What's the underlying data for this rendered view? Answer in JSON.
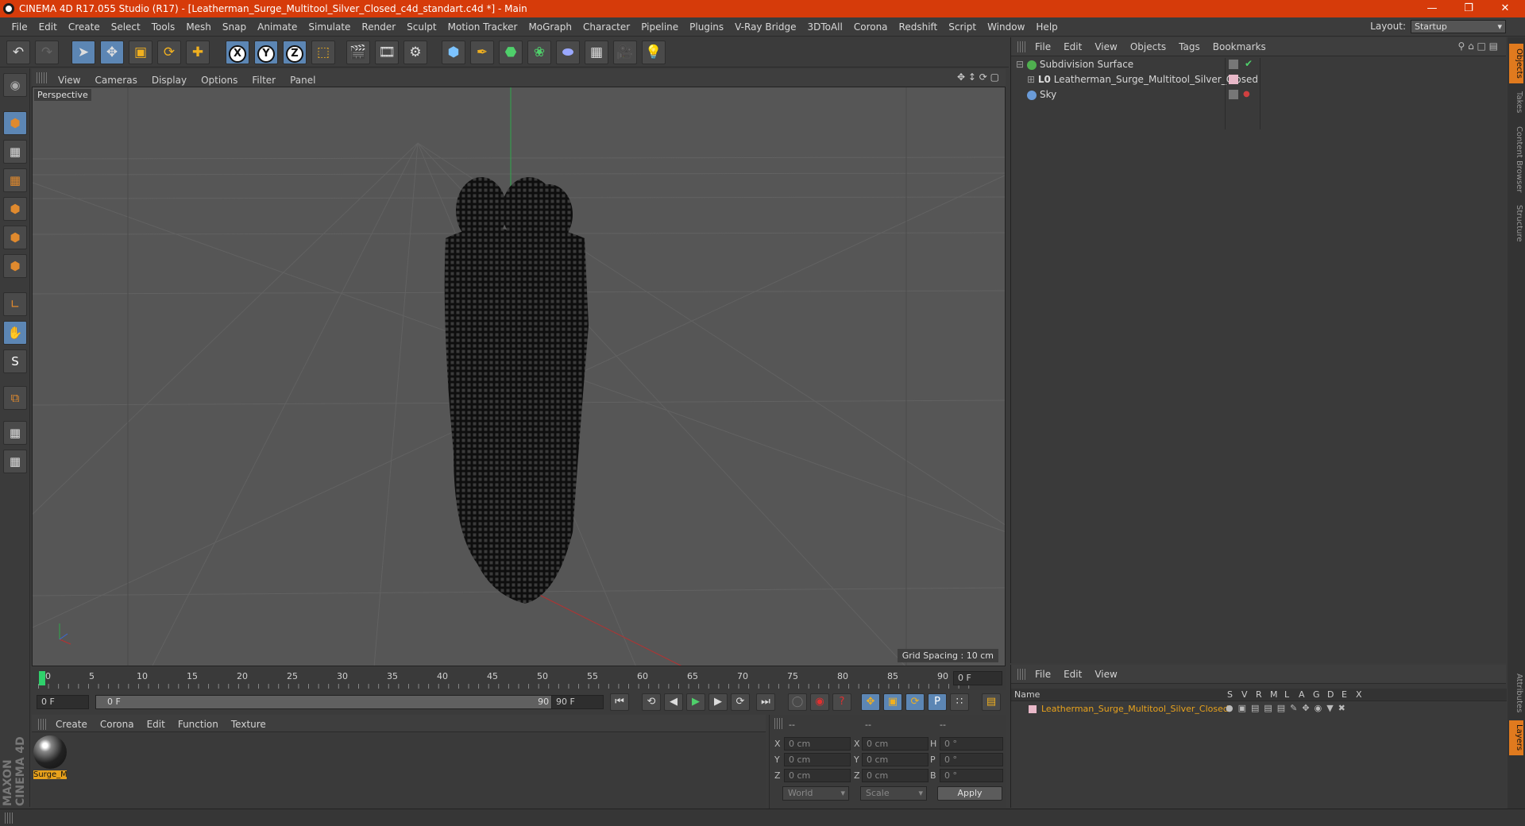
{
  "window": {
    "title": "CINEMA 4D R17.055 Studio (R17) - [Leatherman_Surge_Multitool_Silver_Closed_c4d_standart.c4d *] - Main"
  },
  "menubar": [
    "File",
    "Edit",
    "Create",
    "Select",
    "Tools",
    "Mesh",
    "Snap",
    "Animate",
    "Simulate",
    "Render",
    "Sculpt",
    "Motion Tracker",
    "MoGraph",
    "Character",
    "Pipeline",
    "Plugins",
    "V-Ray Bridge",
    "3DToAll",
    "Corona",
    "Redshift",
    "Script",
    "Window",
    "Help"
  ],
  "layout": {
    "label": "Layout:",
    "value": "Startup"
  },
  "toolbar": {
    "x_axis": "X",
    "y_axis": "Y",
    "z_axis": "Z"
  },
  "viewport": {
    "menu": [
      "View",
      "Cameras",
      "Display",
      "Options",
      "Filter",
      "Panel"
    ],
    "label": "Perspective",
    "grid_spacing": "Grid Spacing : 10 cm"
  },
  "objects": {
    "menu": [
      "File",
      "Edit",
      "View",
      "Objects",
      "Tags",
      "Bookmarks"
    ],
    "items": [
      {
        "name": "Subdivision Surface",
        "color": "#4fb04f"
      },
      {
        "name": "Leatherman_Surge_Multitool_Silver_Closed",
        "color": "#cfcfcf"
      },
      {
        "name": "Sky",
        "color": "#6a9bd8"
      }
    ]
  },
  "sidetabs": [
    "Objects",
    "Takes",
    "Content Browser",
    "Structure"
  ],
  "sidetabs_bottom": [
    "Attributes",
    "Layers"
  ],
  "timeline": {
    "ticks": [
      "0",
      "5",
      "10",
      "15",
      "20",
      "25",
      "30",
      "35",
      "40",
      "45",
      "50",
      "55",
      "60",
      "65",
      "70",
      "75",
      "80",
      "85",
      "90"
    ],
    "frame_display": "0 F",
    "start": "0 F",
    "range_start": "0 F",
    "range_end": "90 F",
    "end": "90 F"
  },
  "materials": {
    "menu": [
      "Create",
      "Corona",
      "Edit",
      "Function",
      "Texture"
    ],
    "items": [
      {
        "name": "Surge_M"
      }
    ]
  },
  "coords": {
    "headers": [
      "--",
      "--",
      "--"
    ],
    "rows": [
      {
        "a": "X",
        "av": "0 cm",
        "b": "X",
        "bv": "0 cm",
        "c": "H",
        "cv": "0 °"
      },
      {
        "a": "Y",
        "av": "0 cm",
        "b": "Y",
        "bv": "0 cm",
        "c": "P",
        "cv": "0 °"
      },
      {
        "a": "Z",
        "av": "0 cm",
        "b": "Z",
        "bv": "0 cm",
        "c": "B",
        "cv": "0 °"
      }
    ],
    "world": "World",
    "scale": "Scale",
    "apply": "Apply"
  },
  "layers": {
    "menu": [
      "File",
      "Edit",
      "View"
    ],
    "name_header": "Name",
    "cols": [
      "S",
      "V",
      "R",
      "M",
      "L",
      "A",
      "G",
      "D",
      "E",
      "X"
    ],
    "item": "Leatherman_Surge_Multitool_Silver_Closed",
    "item_color": "#e8a21c"
  },
  "brand": "MAXON CINEMA 4D"
}
